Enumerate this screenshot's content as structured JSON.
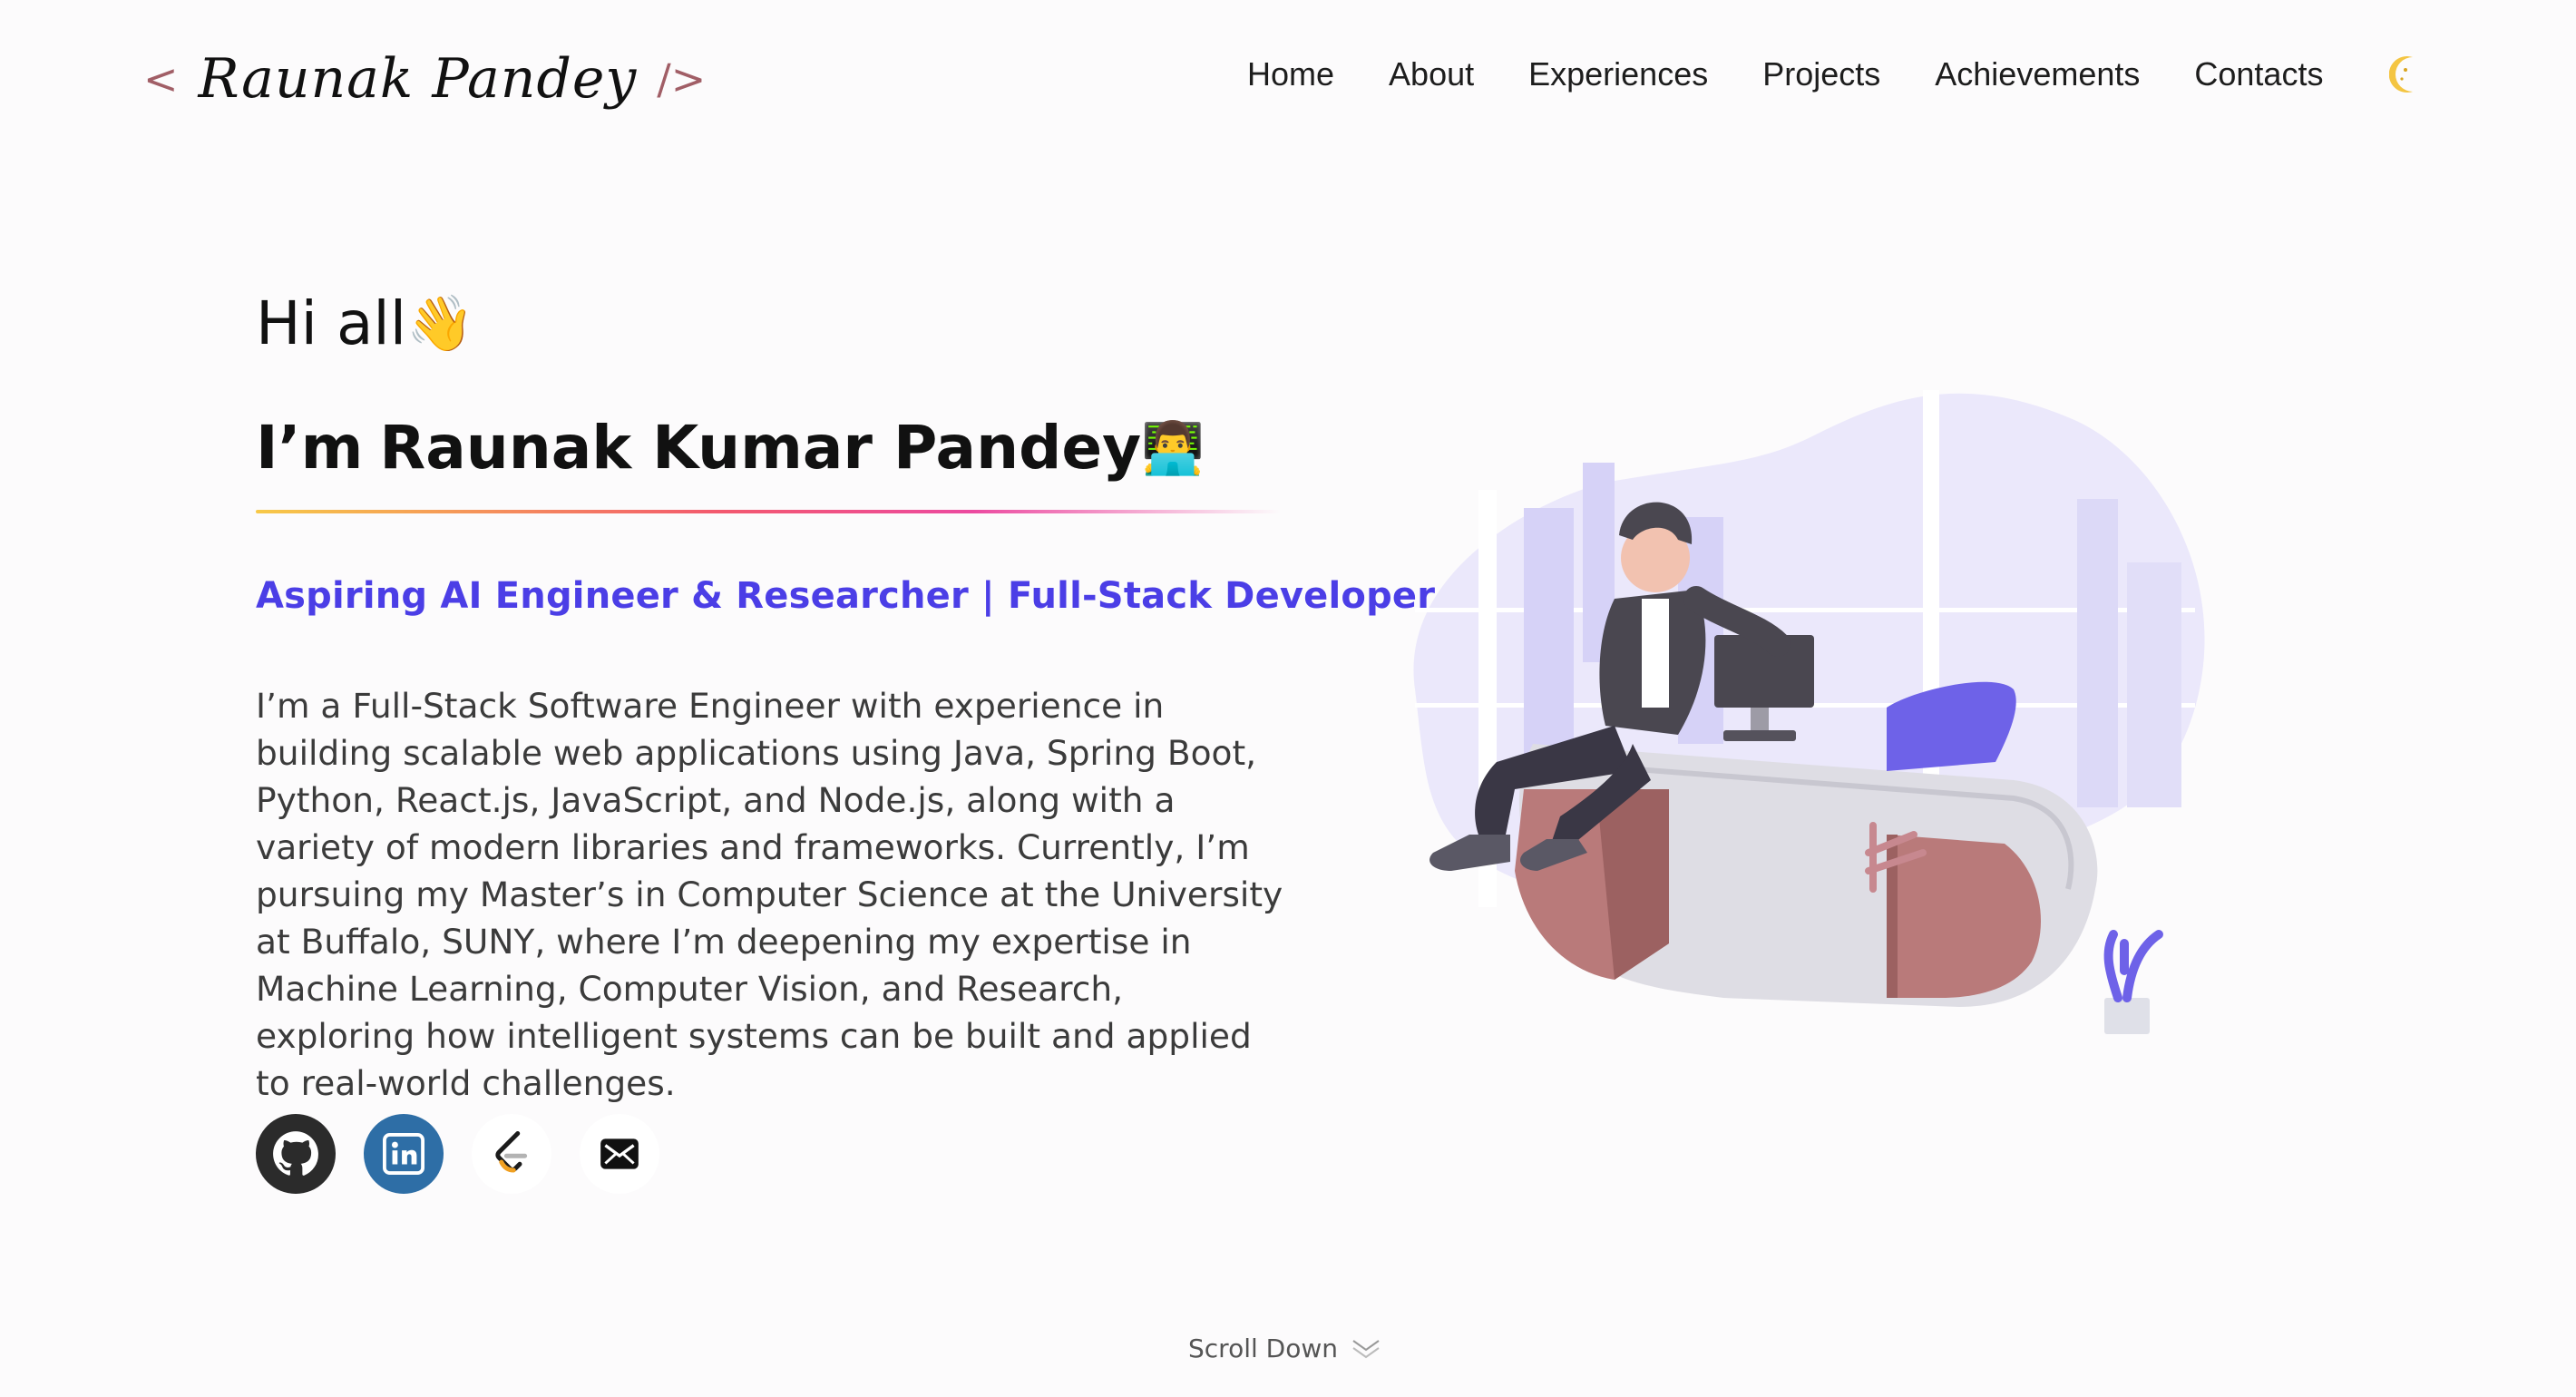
{
  "header": {
    "logo_open": "<",
    "logo_name": "Raunak Pandey",
    "logo_close": "/>",
    "nav": [
      "Home",
      "About",
      "Experiences",
      "Projects",
      "Achievements",
      "Contacts"
    ],
    "theme_toggle_icon": "moon-icon"
  },
  "hero": {
    "greeting": "Hi all",
    "greeting_emoji": "👋",
    "intro_prefix": "I’m",
    "name": "Raunak Kumar Pandey",
    "name_emoji": "👨‍💻",
    "tagline": "Aspiring AI Engineer & Researcher | Full-Stack Developer",
    "bio": "I’m a Full-Stack Software Engineer with experience in building scalable web applications using Java, Spring Boot, Python, React.js, JavaScript, and Node.js, along with a variety of modern libraries and frameworks. Currently, I’m pursuing my Master’s in Computer Science at the University at Buffalo, SUNY, where I’m deepening my expertise in Machine Learning, Computer Vision, and Research, exploring how intelligent systems can be built and applied to real-world challenges."
  },
  "socials": [
    {
      "name": "github",
      "icon": "github-icon"
    },
    {
      "name": "linkedin",
      "icon": "linkedin-icon"
    },
    {
      "name": "leetcode",
      "icon": "leetcode-icon"
    },
    {
      "name": "email",
      "icon": "email-icon"
    }
  ],
  "scroll_label": "Scroll Down",
  "colors": {
    "accent": "#4b3ee6",
    "logo_bracket": "#a15e66",
    "github_bg": "#2b2b2b",
    "linkedin_bg": "#2e6ea6"
  }
}
